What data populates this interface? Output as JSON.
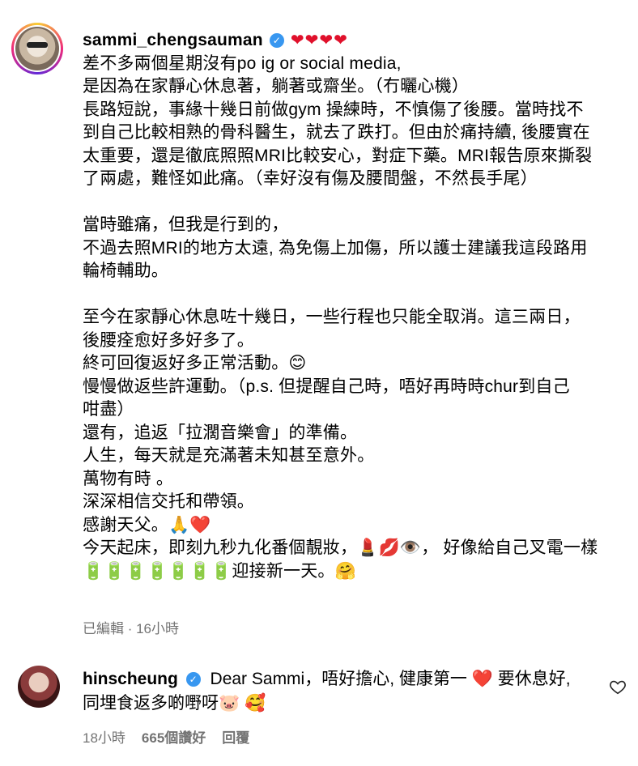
{
  "post": {
    "username": "sammi_chengsauman",
    "hearts": "❤❤❤❤",
    "caption_lines": [
      "差不多兩個星期沒有po ig or social media,",
      "是因為在家靜心休息著，躺著或齋坐。（冇曬心機）",
      "長路短說，事緣十幾日前做gym 操練時，不慎傷了後腰。當時找不",
      "到自己比較相熟的骨科醫生，就去了跌打。但由於痛持續, 後腰實在",
      "太重要，還是徹底照照MRI比較安心，對症下藥。MRI報告原來撕裂",
      "了兩處，難怪如此痛。（幸好沒有傷及腰間盤，不然長手尾）",
      "",
      "當時雖痛，但我是行到的，",
      "不過去照MRI的地方太遠, 為免傷上加傷，所以護士建議我這段路用",
      "輪椅輔助。",
      "",
      "至今在家靜心休息咗十幾日，一些行程也只能全取消。這三兩日，",
      "後腰痊愈好多好多了。",
      "終可回復返好多正常活動。😊",
      "慢慢做返些許運動。（p.s. 但提醒自己時，唔好再時時chur到自己",
      "咁盡）",
      "還有，追返「拉濶音樂會」的準備。",
      "人生，每天就是充滿著未知甚至意外。",
      "萬物有時 。",
      "深深相信交托和帶領。",
      "感謝天父。🙏❤️",
      "今天起床，即刻九秒九化番個靚妝，💄💋👁️， 好像給自己叉電一樣",
      "🔋🔋🔋🔋🔋🔋🔋迎接新一天。🤗"
    ],
    "edited_label": "已編輯 · 16小時"
  },
  "comment": {
    "username": "hinscheung",
    "text_before_heart": "Dear Sammi，唔好擔心, 健康第一",
    "heart": "❤️",
    "text_after_heart": "要休息好,",
    "line2": "同埋食返多啲嘢呀🐷 🥰",
    "time": "18小時",
    "likes": "665個讚好",
    "reply_label": "回覆"
  },
  "icons": {
    "verified": "verified-badge-icon",
    "like": "heart-outline-icon"
  },
  "colors": {
    "verified": "#3897f0",
    "heart": "#e0102b",
    "muted": "#737373"
  }
}
